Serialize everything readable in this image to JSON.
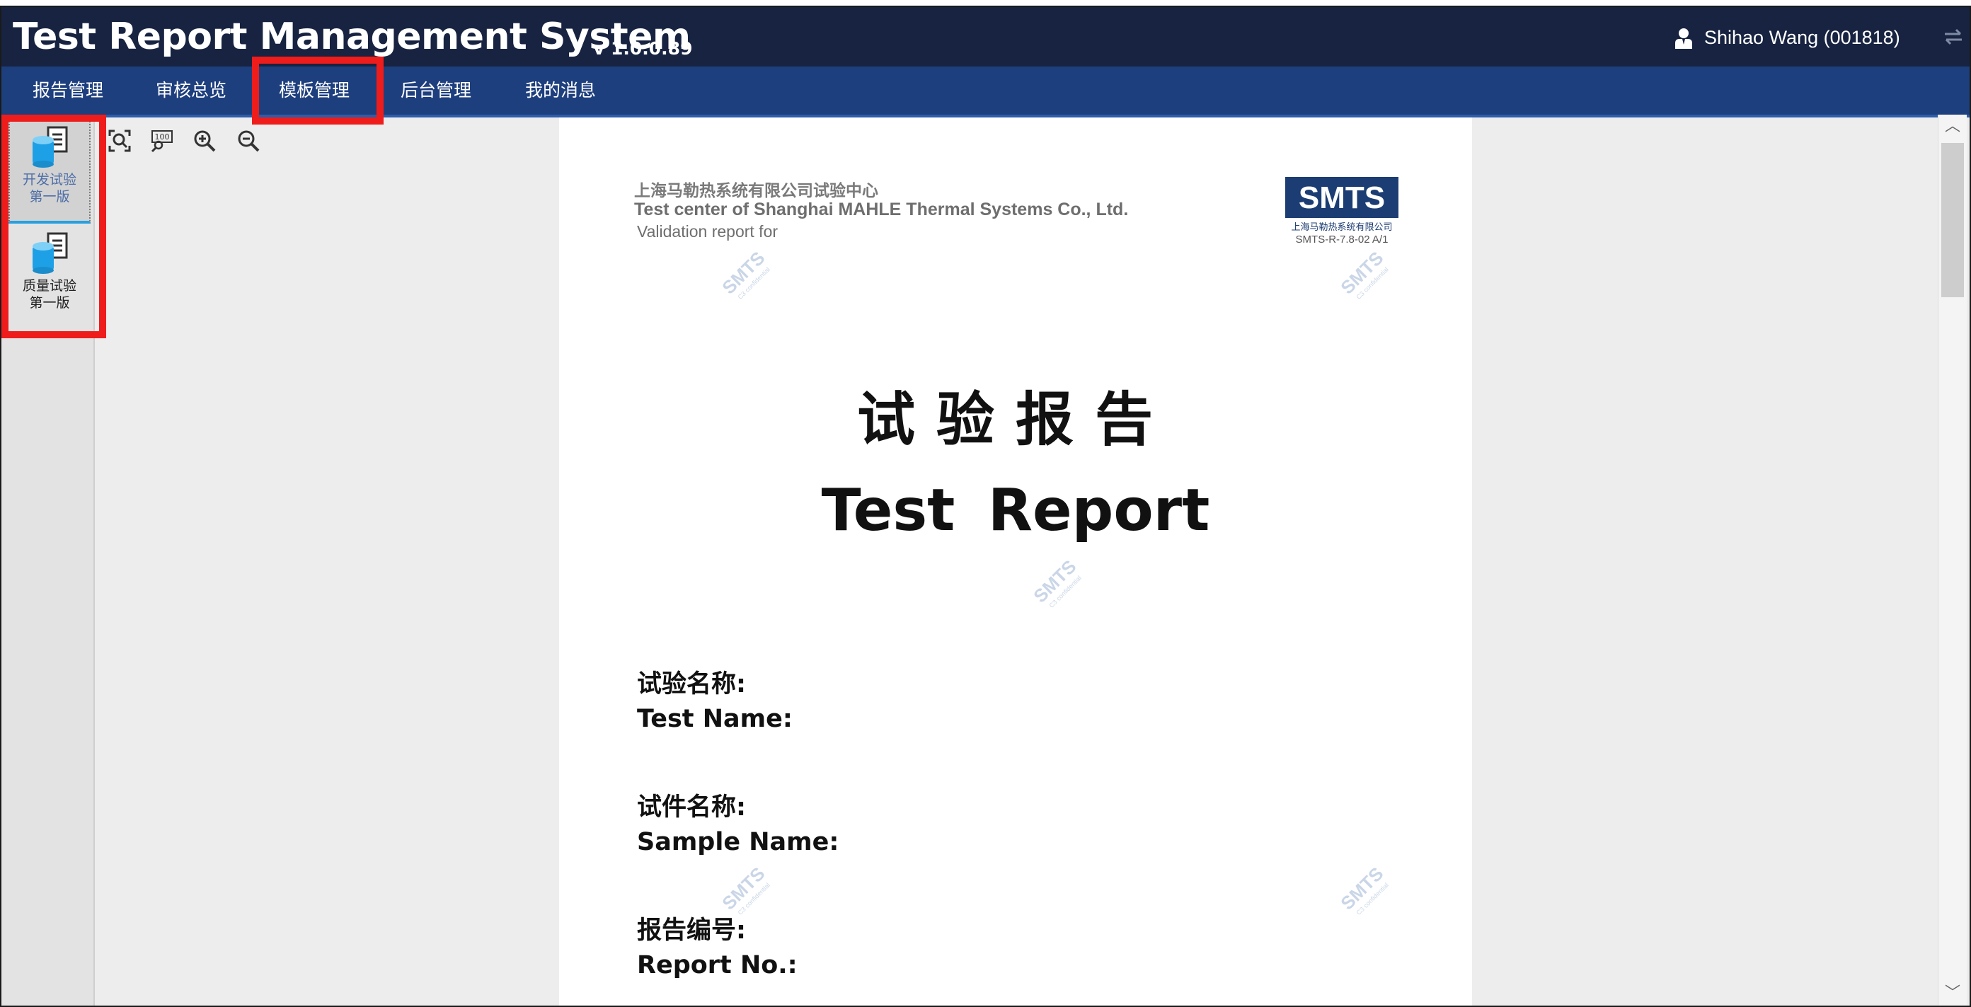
{
  "app": {
    "title": "Test Report Management System",
    "version": "v 1.0.0.89",
    "user": "Shihao Wang (001818)"
  },
  "nav": {
    "items": [
      {
        "label": "报告管理"
      },
      {
        "label": "审核总览"
      },
      {
        "label": "模板管理"
      },
      {
        "label": "后台管理"
      },
      {
        "label": "我的消息"
      }
    ],
    "selected": "模板管理"
  },
  "templates": [
    {
      "line1": "开发试验",
      "line2": "第一版",
      "selected": true
    },
    {
      "line1": "质量试验",
      "line2": "第一版",
      "selected": false
    }
  ],
  "toolbar": {
    "icons": [
      "fit-page-icon",
      "actual-size-100-icon",
      "zoom-in-icon",
      "zoom-out-icon"
    ]
  },
  "document": {
    "company_cn": "上海马勒热系统有限公司试验中心",
    "company_en": "Test center of Shanghai MAHLE Thermal Systems Co., Ltd.",
    "validation": "Validation report for",
    "logo": "SMTS",
    "logo_sub": "上海马勒热系统有限公司",
    "doc_code": "SMTS-R-7.8-02 A/1",
    "title_cn": "试验报告",
    "title_en": "Test  Report",
    "fields": [
      {
        "cn": "试验名称:",
        "en": "Test Name:"
      },
      {
        "cn": "试件名称:",
        "en": "Sample Name:"
      },
      {
        "cn": "报告编号:",
        "en": "Report No.:"
      }
    ],
    "watermark": "SMTS",
    "watermark_sub": "C3 confidential"
  },
  "colors": {
    "titlebar": "#172341",
    "navbar": "#1e3f7e",
    "highlight": "#ef1c1c",
    "logo_bg": "#1c3d73"
  }
}
